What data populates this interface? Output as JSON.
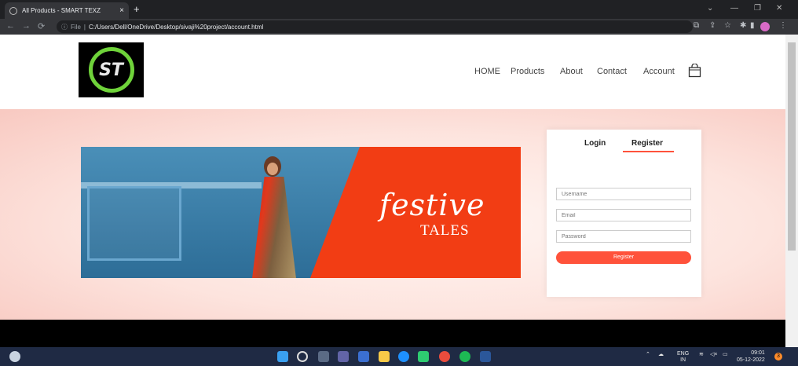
{
  "browser": {
    "tab_title": "All Products - SMART TEXZ",
    "tab_close": "×",
    "new_tab": "+",
    "url_prefix": "File",
    "url": "C:/Users/Dell/OneDrive/Desktop/sivaji%20project/account.html"
  },
  "header": {
    "logo_text": "ST",
    "nav": [
      "HOME",
      "Products",
      "About",
      "Contact",
      "Account"
    ]
  },
  "banner": {
    "headline": "festive",
    "subline": "TALES"
  },
  "form": {
    "tab_login": "Login",
    "tab_register": "Register",
    "username_placeholder": "Username",
    "email_placeholder": "Email",
    "password_placeholder": "Password",
    "submit_label": "Register"
  },
  "taskbar": {
    "lang_top": "ENG",
    "lang_bottom": "IN",
    "time": "09:01",
    "date": "05-12-2022",
    "notifications": "3"
  },
  "colors": {
    "accent": "#ff523b",
    "hero_bg": "#fde4de",
    "logo_ring": "#6fd33a",
    "banner_red": "#f23d14"
  }
}
